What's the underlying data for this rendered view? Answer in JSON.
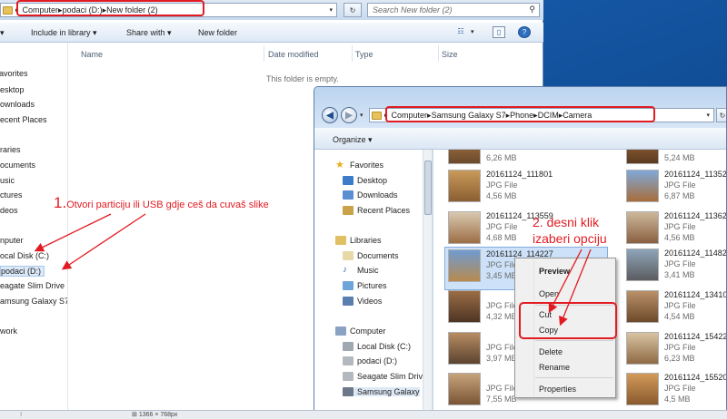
{
  "back_window": {
    "breadcrumb": [
      "Computer",
      "podaci (D:)",
      "New folder (2)"
    ],
    "search_placeholder": "Search New folder (2)",
    "toolbar": {
      "include_library": "Include in library",
      "share_with": "Share with",
      "new_folder": "New folder"
    },
    "columns": {
      "name": "Name",
      "date_modified": "Date modified",
      "type": "Type",
      "size": "Size"
    },
    "empty_message": "This folder is empty.",
    "nav_items": [
      "avorites",
      "esktop",
      "ownloads",
      "ecent Places",
      "raries",
      "ocuments",
      "usic",
      "ctures",
      "deos",
      "nputer",
      "ocal Disk (C:)",
      "podaci (D:)",
      "eagate Slim Drive",
      "amsung Galaxy S7",
      "work"
    ]
  },
  "front_window": {
    "breadcrumb": [
      "Computer",
      "Samsung Galaxy S7",
      "Phone",
      "DCIM",
      "Camera"
    ],
    "organize": "Organize",
    "nav_items": {
      "favorites": "Favorites",
      "desktop": "Desktop",
      "downloads": "Downloads",
      "recent": "Recent Places",
      "libraries": "Libraries",
      "documents": "Documents",
      "music": "Music",
      "pictures": "Pictures",
      "videos": "Videos",
      "computer": "Computer",
      "local_disk": "Local Disk (C:)",
      "podaci": "podaci (D:)",
      "seagate": "Seagate Slim Driv",
      "samsung": "Samsung Galaxy"
    },
    "files_left": [
      {
        "name": "",
        "type": "",
        "size": "6,26 MB"
      },
      {
        "name": "20161124_111801",
        "type": "JPG File",
        "size": "4,56 MB"
      },
      {
        "name": "20161124_113559",
        "type": "JPG File",
        "size": "4,68 MB"
      },
      {
        "name": "20161124_114227",
        "type": "JPG File",
        "size": "3,45 MB"
      },
      {
        "name": "",
        "type": "JPG File",
        "size": "4,32 MB"
      },
      {
        "name": "",
        "type": "JPG File",
        "size": "3,97 MB"
      },
      {
        "name": "",
        "type": "JPG File",
        "size": "7,55 MB"
      }
    ],
    "files_right": [
      {
        "name": "",
        "type": "",
        "size": "5,24 MB"
      },
      {
        "name": "20161124_11352",
        "type": "JPG File",
        "size": "6,87 MB"
      },
      {
        "name": "20161124_11362",
        "type": "JPG File",
        "size": "4,56 MB"
      },
      {
        "name": "20161124_11482",
        "type": "JPG File",
        "size": "3,41 MB"
      },
      {
        "name": "20161124_13410",
        "type": "JPG File",
        "size": "4,54 MB"
      },
      {
        "name": "20161124_15422",
        "type": "JPG File",
        "size": "6,23 MB"
      },
      {
        "name": "20161124_15520",
        "type": "JPG File",
        "size": "4,5 MB"
      }
    ]
  },
  "context_menu": {
    "preview": "Preview",
    "open": "Open",
    "cut": "Cut",
    "copy": "Copy",
    "delete": "Delete",
    "rename": "Rename",
    "properties": "Properties"
  },
  "annotations": {
    "step1_num": "1.",
    "step1_text": "Otvori particiju ili USB gdje ceš da cuvaš slike",
    "step2_line1": "2. desni klik",
    "step2_line2": "izaberi opciju"
  },
  "statusbar": {
    "dimensions": "1366 × 768px"
  },
  "colors": {
    "annotation": "#e21b22",
    "selection": "#cde2f8",
    "window_frame": "#c5d8ef"
  }
}
